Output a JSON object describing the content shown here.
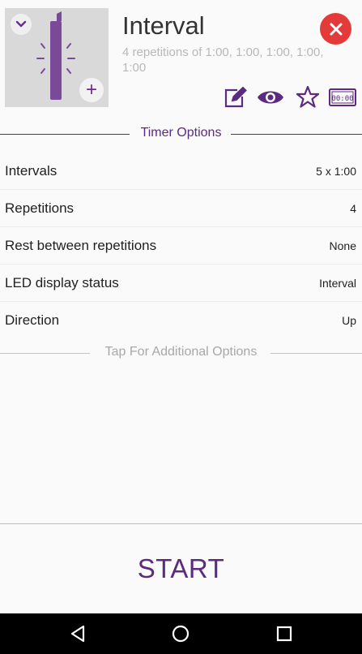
{
  "header": {
    "title": "Interval",
    "subtitle": "4 repetitions of 1:00, 1:00, 1:00, 1:00, 1:00"
  },
  "icons": {
    "collapse": "chevron-down-icon",
    "add": "plus-icon",
    "close": "close-icon",
    "edit": "edit-icon",
    "preview": "eye-icon",
    "favorite": "star-icon",
    "led": "led-display-icon",
    "led_text": "00:00",
    "add_glyph": "+"
  },
  "colors": {
    "accent": "#5c2a80",
    "close": "#e33a3a",
    "thumbnail_bg": "#d9d9d9"
  },
  "timer_options": {
    "heading": "Timer Options",
    "rows": [
      {
        "label": "Intervals",
        "value": "5 x 1:00"
      },
      {
        "label": "Repetitions",
        "value": "4"
      },
      {
        "label": "Rest between repetitions",
        "value": "None"
      },
      {
        "label": "LED display status",
        "value": "Interval"
      },
      {
        "label": "Direction",
        "value": "Up"
      }
    ],
    "more": "Tap For Additional Options"
  },
  "start_label": "START",
  "navbar": {
    "back": "back-icon",
    "home": "home-icon",
    "recents": "recents-icon"
  }
}
